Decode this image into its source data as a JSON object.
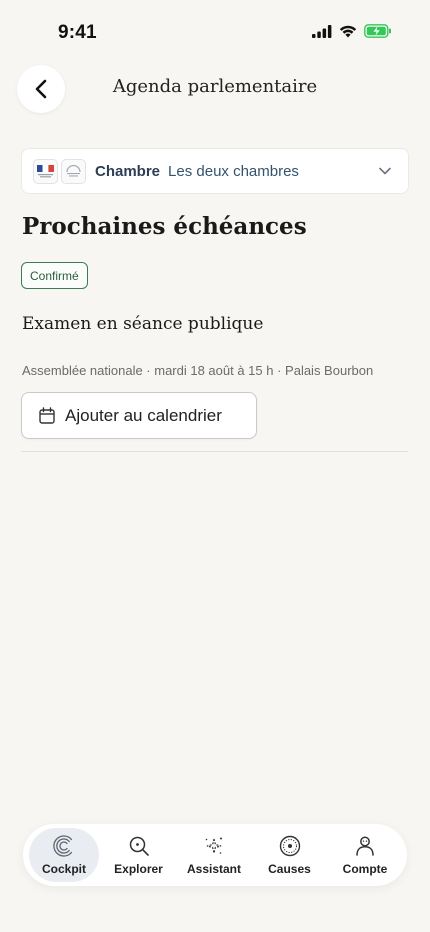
{
  "status_bar": {
    "time": "9:41"
  },
  "header": {
    "title": "Agenda parlementaire"
  },
  "chamber_selector": {
    "label": "Chambre",
    "value": "Les deux chambres"
  },
  "section": {
    "title": "Prochaines échéances"
  },
  "event": {
    "status": "Confirmé",
    "status_color": "#3e7a55",
    "title": "Examen en séance publique",
    "meta": "Assemblée nationale · mardi 18 août à 15 h · Palais Bourbon",
    "add_calendar_label": "Ajouter au calendrier"
  },
  "nav": {
    "active": "Cockpit",
    "items": [
      {
        "label": "Cockpit",
        "icon": "cockpit-icon"
      },
      {
        "label": "Explorer",
        "icon": "search-icon"
      },
      {
        "label": "Assistant",
        "icon": "sparkle-icon"
      },
      {
        "label": "Causes",
        "icon": "causes-icon"
      },
      {
        "label": "Compte",
        "icon": "user-icon"
      }
    ]
  },
  "colors": {
    "background": "#f8f6f2",
    "accent": "#2d3e55",
    "battery": "#34c759"
  }
}
